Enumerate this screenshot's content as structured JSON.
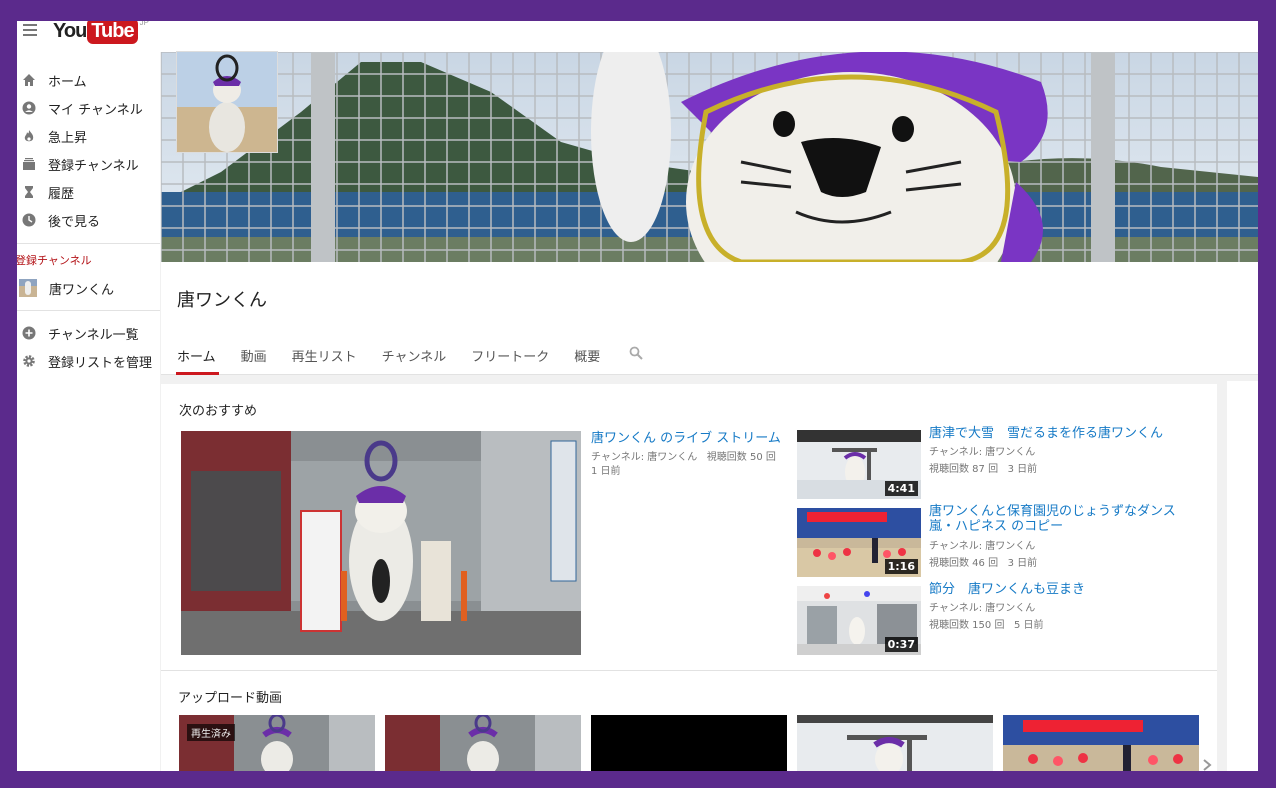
{
  "masthead": {
    "logo_you": "You",
    "logo_tube": "Tube",
    "logo_sup": "JP"
  },
  "sidebar": {
    "items": [
      {
        "label": "ホーム",
        "icon": "home-icon"
      },
      {
        "label": "マイ チャンネル",
        "icon": "account-icon"
      },
      {
        "label": "急上昇",
        "icon": "flame-icon"
      },
      {
        "label": "登録チャンネル",
        "icon": "subscriptions-icon"
      },
      {
        "label": "履歴",
        "icon": "hourglass-icon"
      },
      {
        "label": "後で見る",
        "icon": "clock-icon"
      }
    ],
    "subscriptions_title": "登録チャンネル",
    "subscriptions": [
      {
        "label": "唐ワンくん"
      }
    ],
    "bottom_items": [
      {
        "label": "チャンネル一覧",
        "icon": "add-circle-icon"
      },
      {
        "label": "登録リストを管理",
        "icon": "gear-icon"
      }
    ]
  },
  "channel": {
    "title": "唐ワンくん",
    "tabs": [
      "ホーム",
      "動画",
      "再生リスト",
      "チャンネル",
      "フリートーク",
      "概要"
    ],
    "active_tab": "ホーム"
  },
  "shelf": {
    "title": "次のおすすめ",
    "featured": {
      "title": "唐ワンくん のライブ ストリーム",
      "channel": "チャンネル: 唐ワンくん",
      "views": "視聴回数 50 回",
      "age": "1 日前"
    },
    "recommended": [
      {
        "title": "唐津で大雪　雪だるまを作る唐ワンくん",
        "channel": "チャンネル: 唐ワンくん",
        "views": "視聴回数 87 回",
        "age": "3 日前",
        "duration": "4:41"
      },
      {
        "title": "唐ワンくんと保育園児のじょうずなダンス　嵐・ハピネス のコピー",
        "channel": "チャンネル: 唐ワンくん",
        "views": "視聴回数 46 回",
        "age": "3 日前",
        "duration": "1:16"
      },
      {
        "title": "節分　唐ワンくんも豆まき",
        "channel": "チャンネル: 唐ワンくん",
        "views": "視聴回数 150 回",
        "age": "5 日前",
        "duration": "0:37"
      }
    ]
  },
  "uploads": {
    "title": "アップロード動画",
    "watched_label": "再生済み"
  },
  "colors": {
    "frame": "#5b2a8c",
    "accent": "#cc181e",
    "link": "#167ac6"
  }
}
